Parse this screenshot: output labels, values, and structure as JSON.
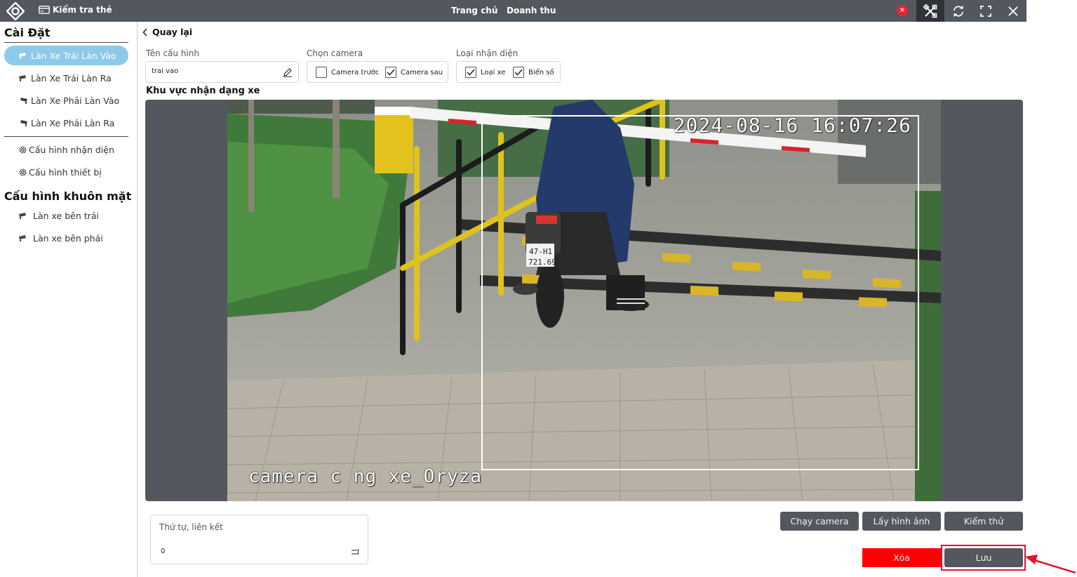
{
  "topbar": {
    "check_card_label": "Kiểm tra thẻ",
    "nav_home": "Trang chủ",
    "nav_revenue": "Doanh thu",
    "error_badge": "×",
    "background_color": "#54585e"
  },
  "sidebar": {
    "settings_heading": "Cài Đặt",
    "lanes": [
      {
        "label": "Làn Xe Trái Làn Vào",
        "icon": "camera-icon",
        "active": true
      },
      {
        "label": "Làn Xe Trái Làn Ra",
        "icon": "camera-icon",
        "active": false
      },
      {
        "label": "Làn Xe Phải Làn Vào",
        "icon": "camera-icon",
        "active": false
      },
      {
        "label": "Làn Xe Phải Làn Ra",
        "icon": "camera-icon",
        "active": false
      }
    ],
    "config_items": [
      {
        "label": "Cấu hình nhận diện",
        "icon": "gear-icon"
      },
      {
        "label": "Cấu hình thiết bị",
        "icon": "gear-icon"
      }
    ],
    "face_heading": "Cấu hình khuôn mặt",
    "face_items": [
      {
        "label": "Làn xe bên trái",
        "icon": "camera-icon"
      },
      {
        "label": "Làn xe bên phải",
        "icon": "camera-icon"
      }
    ],
    "active_color": "#8ccae9"
  },
  "main": {
    "back_label": "Quay lại",
    "config_name": {
      "label": "Tên cấu hình",
      "value": "trai vao"
    },
    "camera_select": {
      "label": "Chọn camera",
      "options": [
        {
          "label": "Camera trước",
          "checked": false
        },
        {
          "label": "Camera sau",
          "checked": true
        }
      ]
    },
    "recognition_type": {
      "label": "Loại nhận diện",
      "options": [
        {
          "label": "Loại xe",
          "checked": true
        },
        {
          "label": "Biển số",
          "checked": true
        }
      ]
    },
    "region_title": "Khu vực nhận dạng xe",
    "video": {
      "timestamp": "2024-08-16 16:07:26",
      "camera_name": "camera c   ng xe_Oryza",
      "plate": "47-H1 721.69"
    },
    "order": {
      "label": "Thứ tự, liên kết",
      "value": "0"
    },
    "buttons": {
      "run_camera": "Chạy camera",
      "get_image": "Lấy hình ảnh",
      "test": "Kiểm thử",
      "delete": "Xóa",
      "save": "Lưu"
    },
    "delete_color": "#ff0000",
    "highlight_color": "#e3132b"
  }
}
